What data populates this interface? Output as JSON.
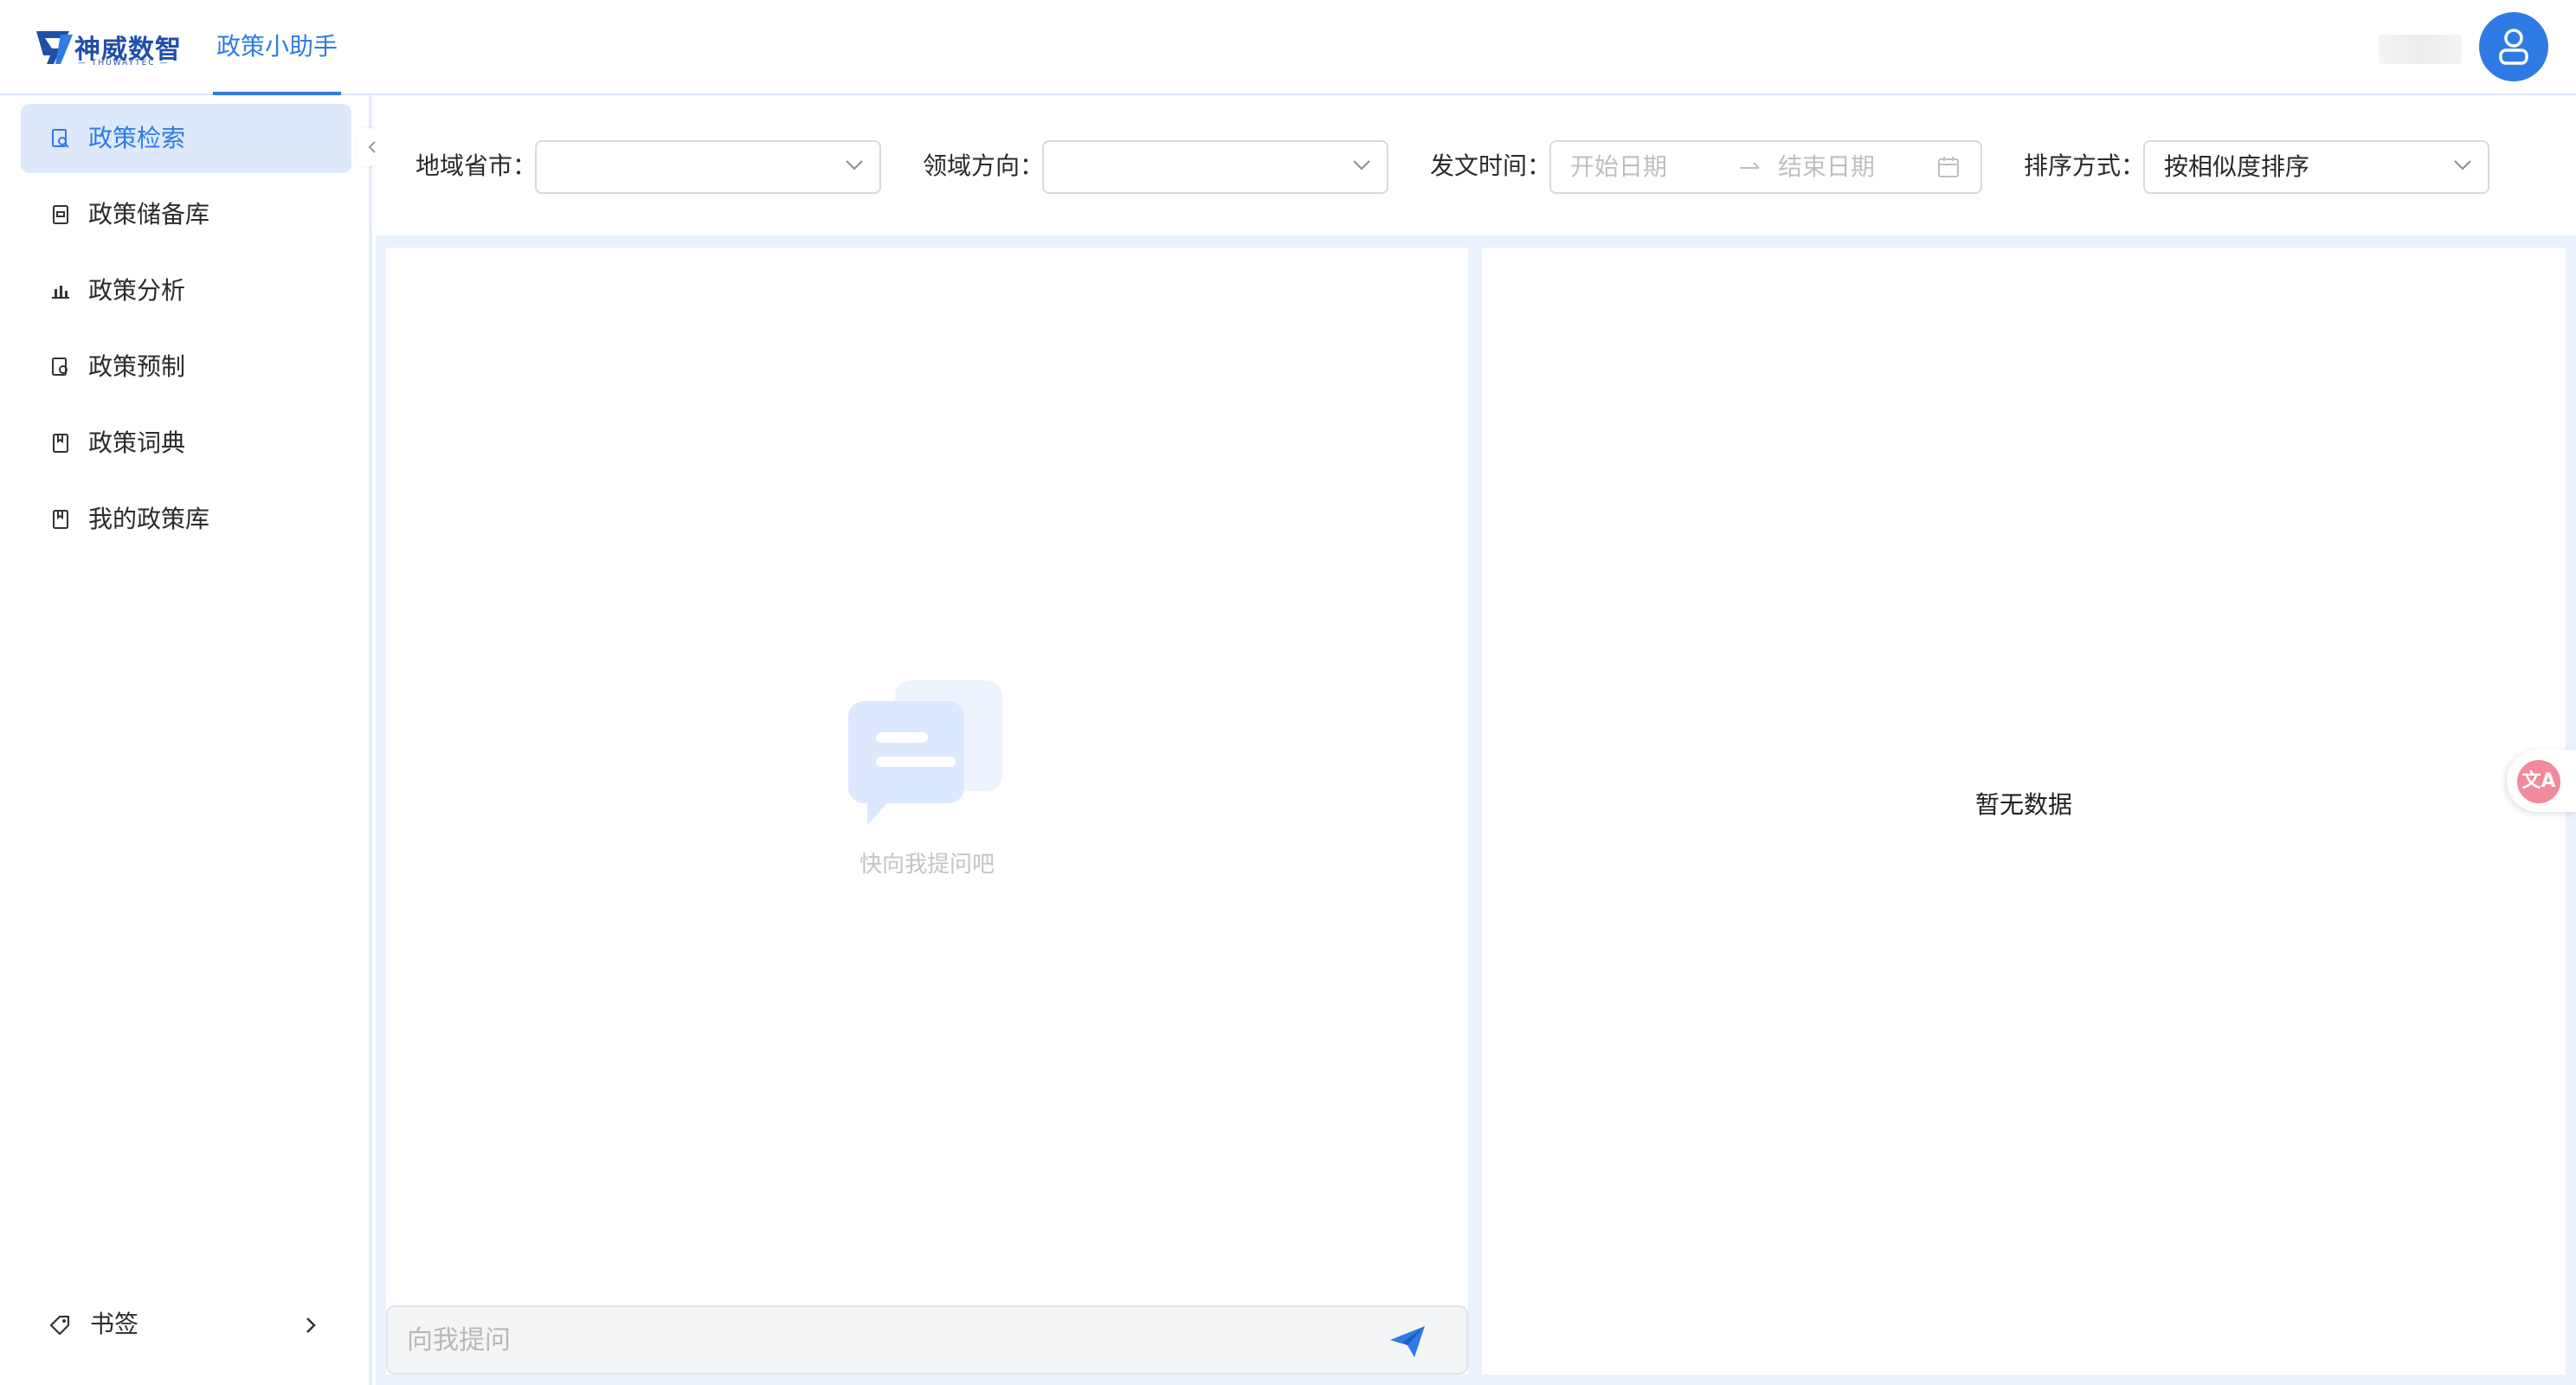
{
  "brand": {
    "name": "神威数智",
    "sub": "— THUWAYTEC —",
    "app_tab": "政策小助手"
  },
  "sidebar": {
    "items": [
      {
        "label": "政策检索",
        "icon": "search-doc-icon",
        "active": true
      },
      {
        "label": "政策储备库",
        "icon": "archive-icon",
        "active": false
      },
      {
        "label": "政策分析",
        "icon": "bar-chart-icon",
        "active": false
      },
      {
        "label": "政策预制",
        "icon": "doc-gear-icon",
        "active": false
      },
      {
        "label": "政策词典",
        "icon": "book-icon",
        "active": false
      },
      {
        "label": "我的政策库",
        "icon": "book-icon",
        "active": false
      }
    ],
    "bookmark": {
      "label": "书签",
      "icon": "tag-icon"
    }
  },
  "filters": {
    "region_label": "地域省市：",
    "region_value": "",
    "field_label": "领域方向：",
    "field_value": "",
    "date_label": "发文时间：",
    "date_start_placeholder": "开始日期",
    "date_end_placeholder": "结束日期",
    "sort_label": "排序方式：",
    "sort_value": "按相似度排序"
  },
  "chat": {
    "empty_text": "快向我提问吧",
    "input_placeholder": "向我提问"
  },
  "results": {
    "empty_text": "暂无数据"
  },
  "fab": {
    "icon": "translate-icon"
  },
  "colors": {
    "accent": "#2f7be5",
    "active_bg": "#dde9fb",
    "content_bg": "#eaf2fd",
    "fab": "#f2899d"
  }
}
